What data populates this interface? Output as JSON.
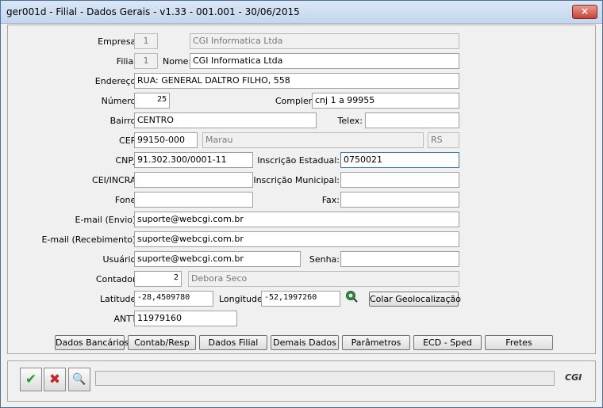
{
  "window": {
    "title": "ger001d - Filial - Dados Gerais - v1.33 - 001.001 - 30/06/2015",
    "close_icon": "×"
  },
  "fields": {
    "empresa_label": "Empresa:",
    "empresa_code": "1",
    "empresa_name": "CGI Informatica Ltda",
    "filial_label": "Filial:",
    "filial_code": "1",
    "nome_label": "Nome:",
    "nome": "CGI Informatica Ltda",
    "endereco_label": "Endereço:",
    "endereco": "RUA: GENERAL DALTRO FILHO, 558",
    "numero_label": "Número:",
    "numero": "25",
    "complemento_label": "Complemento:",
    "complemento": "cnj 1 a 99955",
    "bairro_label": "Bairro:",
    "bairro": "CENTRO",
    "telex_label": "Telex:",
    "telex": "",
    "cep_label": "CEP:",
    "cep": "99150-000",
    "cidade": "Marau",
    "uf": "RS",
    "cnpj_label": "CNPJ:",
    "cnpj": "91.302.300/0001-11",
    "ie_label": "Inscrição Estadual:",
    "ie": "0750021",
    "cei_label": "CEI/INCRA:",
    "cei": "",
    "im_label": "Inscrição Municipal:",
    "im": "",
    "fone_label": "Fone:",
    "fone": "",
    "fax_label": "Fax:",
    "fax": "",
    "email_envio_label": "E-mail (Envio):",
    "email_envio": "suporte@webcgi.com.br",
    "email_receb_label": "E-mail (Recebimento):",
    "email_receb": "suporte@webcgi.com.br",
    "usuario_label": "Usuário:",
    "usuario": "suporte@webcgi.com.br",
    "senha_label": "Senha:",
    "senha": "",
    "contador_label": "Contador:",
    "contador_code": "2",
    "contador_name": "Debora Seco",
    "latitude_label": "Latitude:",
    "latitude": "-28,4509780",
    "longitude_label": "Longitude:",
    "longitude": "-52,1997260",
    "colar_geo": "Colar Geolocalização",
    "antt_label": "ANTT:",
    "antt": "11979160"
  },
  "tabs": [
    "Dados Bancários",
    "Contab/Resp",
    "Dados Filial",
    "Demais Dados",
    "Parâmetros",
    "ECD - Sped",
    "Fretes"
  ],
  "footer": {
    "confirm_icon": "✔",
    "cancel_icon": "✖",
    "search_icon": "🔍",
    "logo": "CGI"
  },
  "colors": {
    "confirm": "#2e9a2e",
    "cancel": "#c0282d"
  }
}
